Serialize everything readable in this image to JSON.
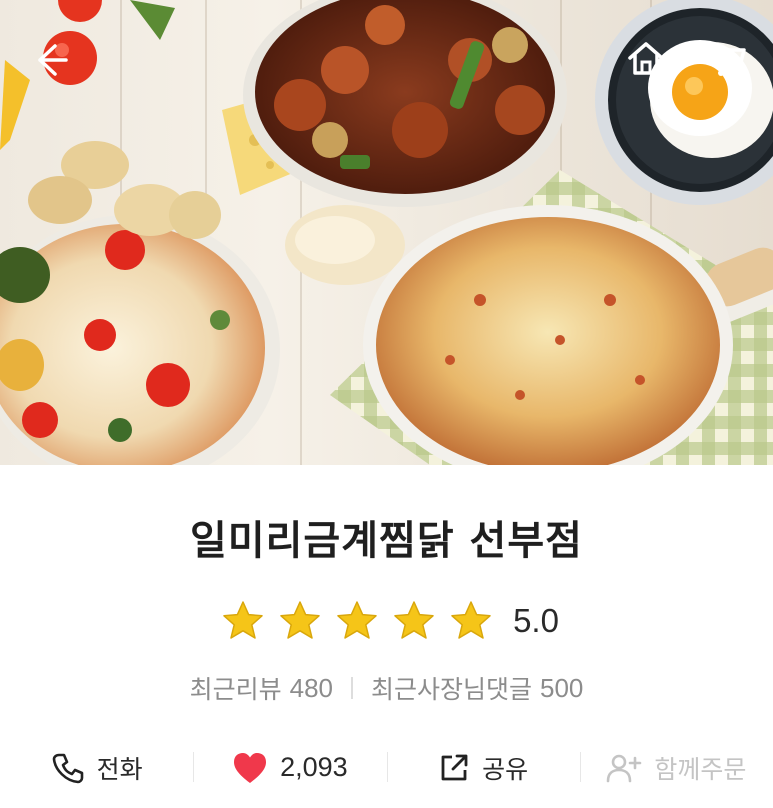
{
  "header": {
    "back_icon": "arrow-left-icon",
    "home_icon": "home-icon",
    "cart_icon": "cart-icon"
  },
  "store": {
    "name": "일미리금계찜닭 선부점",
    "rating": {
      "value": "5.0",
      "stars_filled": 5,
      "stars_total": 5,
      "star_color": "#f5c518"
    },
    "stats": [
      {
        "label": "최근리뷰",
        "value": "480"
      },
      {
        "label": "최근사장님댓글",
        "value": "500"
      }
    ]
  },
  "actions": [
    {
      "id": "call",
      "icon": "phone-icon",
      "label": "전화",
      "enabled": true
    },
    {
      "id": "like",
      "icon": "heart-icon",
      "label": "2,093",
      "enabled": true,
      "icon_color": "#f0384b"
    },
    {
      "id": "share",
      "icon": "share-icon",
      "label": "공유",
      "enabled": true
    },
    {
      "id": "group-order",
      "icon": "add-person-icon",
      "label": "함께주문",
      "enabled": false
    }
  ],
  "colors": {
    "accent_red": "#f0384b",
    "star_yellow": "#f5c518",
    "muted_text": "#8c8c8c",
    "disabled_text": "#c4c4c4"
  }
}
